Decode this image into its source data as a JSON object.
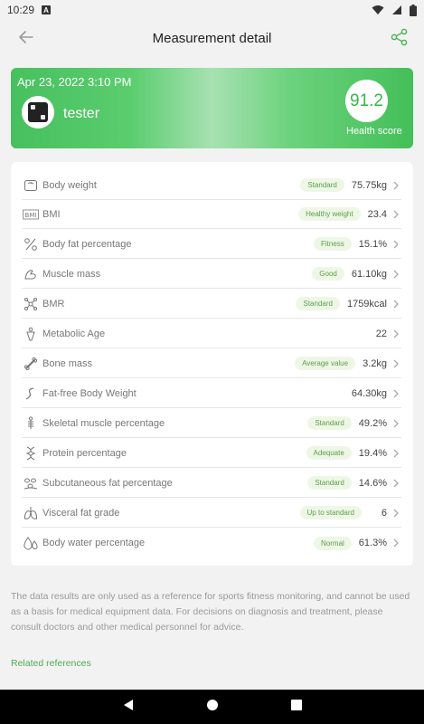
{
  "status_bar": {
    "time": "10:29",
    "notif_letter": "A"
  },
  "header": {
    "title": "Measurement detail"
  },
  "summary": {
    "datetime": "Apr 23, 2022 3:10 PM",
    "username": "tester",
    "score": "91.2",
    "score_label": "Health score"
  },
  "metrics": [
    {
      "name": "Body weight",
      "badge": "Standard",
      "value": "75.75kg",
      "icon": "scale-icon"
    },
    {
      "name": "BMI",
      "badge": "Healthy weight",
      "value": "23.4",
      "icon": "bmi-icon"
    },
    {
      "name": "Body fat percentage",
      "badge": "Fitness",
      "value": "15.1%",
      "icon": "percent-icon"
    },
    {
      "name": "Muscle mass",
      "badge": "Good",
      "value": "61.10kg",
      "icon": "muscle-icon"
    },
    {
      "name": "BMR",
      "badge": "Standard",
      "value": "1759kcal",
      "icon": "molecule-icon"
    },
    {
      "name": "Metabolic Age",
      "badge": "",
      "value": "22",
      "icon": "body-icon"
    },
    {
      "name": "Bone mass",
      "badge": "Average value",
      "value": "3.2kg",
      "icon": "bone-icon"
    },
    {
      "name": "Fat-free Body Weight",
      "badge": "",
      "value": "64.30kg",
      "icon": "curve-icon"
    },
    {
      "name": "Skeletal muscle percentage",
      "badge": "Standard",
      "value": "49.2%",
      "icon": "skeleton-icon"
    },
    {
      "name": "Protein percentage",
      "badge": "Adequate",
      "value": "19.4%",
      "icon": "dna-icon"
    },
    {
      "name": "Subcutaneous fat percentage",
      "badge": "Standard",
      "value": "14.6%",
      "icon": "cells-icon"
    },
    {
      "name": "Visceral fat grade",
      "badge": "Up to standard",
      "value": "6",
      "icon": "lungs-icon"
    },
    {
      "name": "Body water percentage",
      "badge": "Normal",
      "value": "61.3%",
      "icon": "water-drop-icon"
    }
  ],
  "disclaimer": "The data results are only used as a reference for sports fitness monitoring, and cannot be used as a basis for medical equipment data. For decisions on diagnosis and treatment, please consult doctors and other medical personnel for advice.",
  "related_link": "Related references",
  "colors": {
    "accent": "#4caf50",
    "badge_bg": "#eef7e6",
    "badge_text": "#5d9e4a"
  }
}
